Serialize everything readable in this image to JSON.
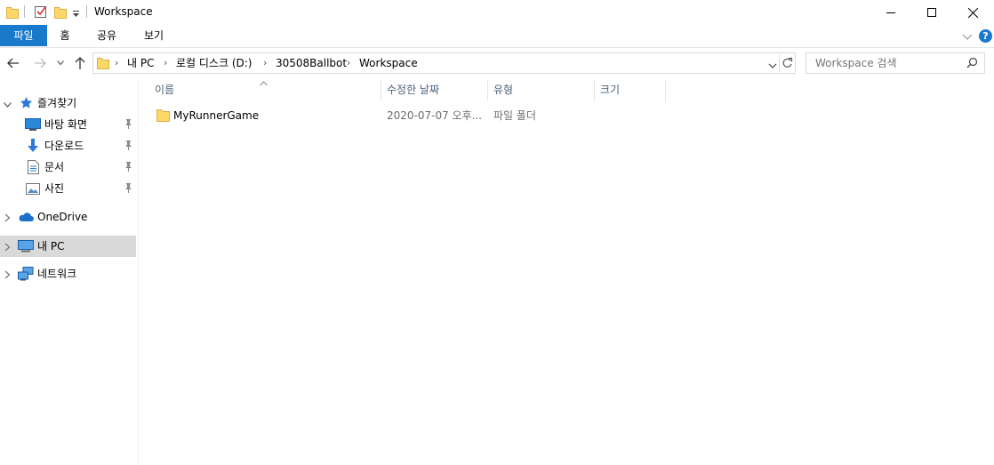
{
  "window": {
    "title": "Workspace",
    "minimize_glyph": "—",
    "maximize_glyph": "☐",
    "close_glyph": "✕"
  },
  "ribbon": {
    "tabs": [
      {
        "label": "파일",
        "active": true
      },
      {
        "label": "홈",
        "active": false
      },
      {
        "label": "공유",
        "active": false
      },
      {
        "label": "보기",
        "active": false
      }
    ],
    "help_glyph": "?"
  },
  "address": {
    "breadcrumbs": [
      "내 PC",
      "로컬 디스크 (D:)",
      "30508Ballbot",
      "Workspace"
    ],
    "separator": "›"
  },
  "search": {
    "placeholder": "Workspace 검색"
  },
  "nav": {
    "quick_access": "즐겨찾기",
    "pinned": [
      "바탕 화면",
      "다운로드",
      "문서",
      "사진"
    ],
    "onedrive": "OneDrive",
    "this_pc": "내 PC",
    "network": "네트워크"
  },
  "columns": {
    "name": "이름",
    "modified": "수정한 날짜",
    "type": "유형",
    "size": "크기"
  },
  "files": [
    {
      "name": "MyRunnerGame",
      "modified": "2020-07-07 오후...",
      "type": "파일 폴더",
      "size": ""
    }
  ],
  "colors": {
    "accent": "#1979ca",
    "folder": "#ffd766",
    "header_text": "#4c607a",
    "muted_text": "#6d6d6d"
  }
}
